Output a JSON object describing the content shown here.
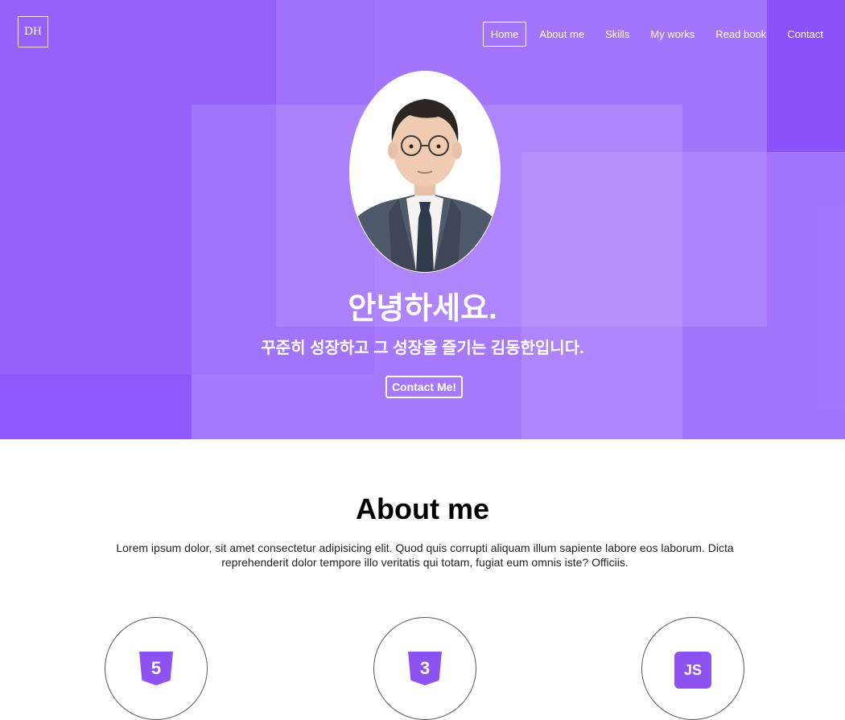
{
  "brand": {
    "logo_text": "DH"
  },
  "nav": {
    "items": [
      {
        "label": "Home",
        "active": true
      },
      {
        "label": "About me",
        "active": false
      },
      {
        "label": "Skills",
        "active": false
      },
      {
        "label": "My works",
        "active": false
      },
      {
        "label": "Read book",
        "active": false
      },
      {
        "label": "Contact",
        "active": false
      }
    ]
  },
  "hero": {
    "title": "안녕하세요.",
    "subtitle": "꾸준히 성장하고 그 성장을 즐기는 김동한입니다.",
    "cta_label": "Contact Me!"
  },
  "about": {
    "title": "About me",
    "text": "Lorem ipsum dolor, sit amet consectetur adipisicing elit. Quod quis corrupti aliquam illum sapiente labore eos laborum. Dicta reprehenderit dolor tempore illo veritatis qui totam, fugiat eum omnis iste? Officiis.",
    "skills": [
      {
        "icon": "html5-icon",
        "glyph": "5"
      },
      {
        "icon": "css3-icon",
        "glyph": "3"
      },
      {
        "icon": "javascript-icon",
        "glyph": "JS"
      }
    ]
  },
  "colors": {
    "hero_bg": "#9a66fb",
    "accent": "#8d52ef",
    "text": "#ffffff"
  }
}
